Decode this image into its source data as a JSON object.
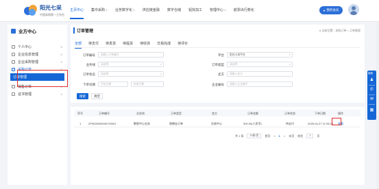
{
  "header": {
    "brand_name": "阳光七采",
    "brand_sub": "中国采购第一工作台",
    "nav": [
      {
        "label": "主页中心",
        "has_chevron": false,
        "active": true
      },
      {
        "label": "集中采购",
        "has_chevron": true,
        "active": false
      },
      {
        "label": "业务数字化",
        "has_chevron": true,
        "active": false
      },
      {
        "label": "供应链金融",
        "has_chevron": false,
        "active": false
      },
      {
        "label": "数字仓储",
        "has_chevron": false,
        "active": false
      },
      {
        "label": "铝找加工",
        "has_chevron": false,
        "active": false
      },
      {
        "label": "管理中心",
        "has_chevron": true,
        "active": false
      },
      {
        "label": "航票出行数化",
        "has_chevron": false,
        "active": false
      }
    ],
    "member_button": "我的会员"
  },
  "sidebar": {
    "title": "业方中心",
    "items": [
      {
        "label": "个人中心",
        "chevron": "∨"
      },
      {
        "label": "企业信息管理",
        "chevron": "∨"
      },
      {
        "label": "企业采购管理",
        "chevron": "∨"
      },
      {
        "label": "采购订单",
        "chevron": "∧",
        "open": true
      },
      {
        "label": "订单管理",
        "sub": true,
        "active": true
      },
      {
        "label": "销售订单",
        "chevron": "∨"
      },
      {
        "label": "证书管理",
        "chevron": "∨"
      }
    ]
  },
  "main": {
    "title": "订单管理",
    "breadcrumb": "● 当前位置：采购订单 > 订单管理",
    "tabs": [
      "全部",
      "待支付",
      "待发货",
      "待提货",
      "待收货",
      "交易完成",
      "待评价"
    ],
    "filters": {
      "order_no": {
        "label": "订单编号",
        "placeholder": "请输入订单编号"
      },
      "platform": {
        "label": "平台",
        "value": "阳光七采平台"
      },
      "business": {
        "label": "业务线",
        "placeholder": "请选择"
      },
      "order_type": {
        "label": "订单类型",
        "placeholder": "请选择"
      },
      "order_status": {
        "label": "订单状态",
        "placeholder": "请选择"
      },
      "seller": {
        "label": "卖方",
        "placeholder": "请输入卖方"
      },
      "order_date": {
        "label": "下单日期",
        "start": "开始日期",
        "end": "结束日期"
      },
      "enterprise_no": {
        "label": "企业编号",
        "placeholder": "请输入企业编号"
      }
    },
    "buttons": {
      "search": "搜索",
      "clear": "清空"
    },
    "table": {
      "headers": [
        "序号",
        "订单编号",
        "业务线",
        "订单类型",
        "卖方",
        "订单金额",
        "订单状态",
        "下单日期",
        "操作"
      ],
      "rows": [
        [
          "1",
          "ZF9000005040720001",
          "数智中心业务",
          "销售挂订单",
          "交易中心",
          "300.00(人民币)",
          "待支付",
          "2025-04-27 11:03:46",
          "查看"
        ]
      ]
    },
    "pager": {
      "total": "共 1 条",
      "page_size": "10条/页",
      "first": "首页",
      "prev": "<",
      "current": "1",
      "next": ">",
      "last": "末页",
      "goto_label": "前往",
      "goto_value": "1",
      "page_unit": "页"
    }
  },
  "float_bar": {
    "label": "客服",
    "icons": [
      "person-icon",
      "phone-icon",
      "mail-icon",
      "qrcode-icon"
    ]
  }
}
